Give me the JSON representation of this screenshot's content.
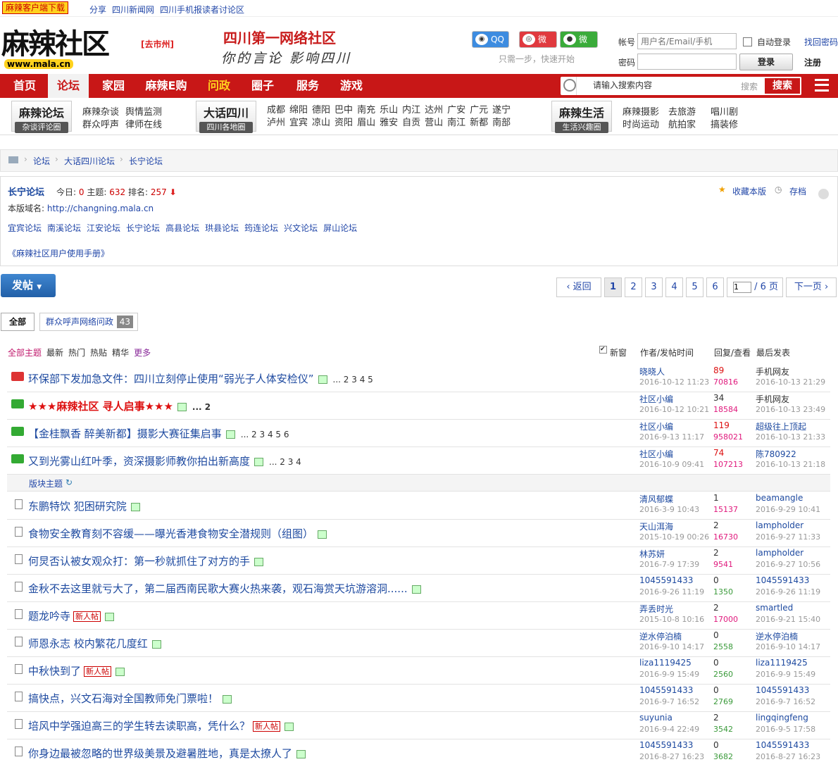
{
  "topbar": {
    "download": "麻辣客户端下载",
    "links": [
      "分享",
      "四川新闻网",
      "四川手机报读者讨论区"
    ]
  },
  "header": {
    "logo": "麻辣社区",
    "logo_url": "www.mala.cn",
    "city": "[去市州]",
    "slogan1": "四川第一网络社区",
    "slogan2": "你的言论 影响四川",
    "social": {
      "qq": "QQ",
      "weibo": "微博",
      "weixin": "微信",
      "quick": "只需一步，快速开始"
    },
    "login": {
      "account_label": "帐号",
      "account_placeholder": "用户名/Email/手机",
      "auto": "自动登录",
      "find_pwd": "找回密码",
      "pwd_label": "密码",
      "login_btn": "登录",
      "register": "注册"
    }
  },
  "nav": {
    "items": [
      "首页",
      "论坛",
      "家园",
      "麻辣E购",
      "问政",
      "圈子",
      "服务",
      "游戏"
    ],
    "search_placeholder": "请输入搜索内容",
    "search_hint": "搜索",
    "search_btn": "搜索"
  },
  "subnav": {
    "box1": {
      "title": "麻辣论坛",
      "sub": "杂谈评论圈"
    },
    "links1": [
      "麻辣杂谈",
      "舆情监测",
      "群众呼声",
      "律师在线"
    ],
    "box2": {
      "title": "大话四川",
      "sub": "四川各地圈"
    },
    "links2a": [
      "成都",
      "绵阳",
      "德阳",
      "巴中",
      "南充",
      "乐山",
      "内江",
      "达州",
      "广安",
      "广元",
      "遂宁"
    ],
    "links2b": [
      "泸州",
      "宜宾",
      "凉山",
      "资阳",
      "眉山",
      "雅安",
      "自贡",
      "营山",
      "南江",
      "新都",
      "南部"
    ],
    "box3": {
      "title": "麻辣生活",
      "sub": "生活兴趣圈"
    },
    "links3": [
      "麻辣摄影",
      "去旅游",
      "唱川剧",
      "时尚运动",
      "航拍家",
      "搞装修"
    ]
  },
  "breadcrumb": [
    "论坛",
    "大话四川论坛",
    "长宁论坛"
  ],
  "forum": {
    "name": "长宁论坛",
    "today_label": "今日:",
    "today": "0",
    "topics_label": "主题:",
    "topics": "632",
    "rank_label": "排名:",
    "rank": "257",
    "domain_label": "本版域名:",
    "domain": "http://changning.mala.cn",
    "fav": "收藏本版",
    "archive": "存档",
    "related": [
      "宜宾论坛",
      "南溪论坛",
      "江安论坛",
      "长宁论坛",
      "高县论坛",
      "珙县论坛",
      "筠连论坛",
      "兴文论坛",
      "屏山论坛"
    ],
    "manual": "《麻辣社区用户使用手册》"
  },
  "toolbar": {
    "post": "发帖",
    "back": "返回",
    "pages": [
      "1",
      "2",
      "3",
      "4",
      "5",
      "6"
    ],
    "page_input": "1",
    "total": "/ 6 页",
    "next": "下一页"
  },
  "tabs": {
    "all": "全部",
    "cat": "群众呼声网络问政",
    "cat_count": "43"
  },
  "list_header": {
    "filters": [
      "全部主题",
      "最新",
      "热门",
      "热贴",
      "精华",
      "更多"
    ],
    "newwin": "新窗",
    "author": "作者/发帖时间",
    "reply": "回复/查看",
    "last": "最后发表"
  },
  "section_label": "版块主题",
  "sticky": [
    {
      "title": "环保部下发加急文件：四川立刻停止使用“弱光子人体安检仪”",
      "pages": "... 2  3  4  5",
      "author": "晓晓人",
      "date": "2016-10-12 11:23",
      "replies": "89",
      "views": "70816",
      "last": "手机网友",
      "last_date": "2016-10-13 21:29"
    },
    {
      "title": "★★★麻辣社区 寻人启事★★★",
      "pages": "... 2",
      "author": "社区小编",
      "date": "2016-10-12 10:21",
      "replies": "34",
      "views": "18584",
      "last": "手机网友",
      "last_date": "2016-10-13 23:49"
    },
    {
      "title": "【金桂飘香 醉美新都】摄影大赛征集启事",
      "pages": "... 2  3  4  5  6",
      "author": "社区小编",
      "date": "2016-9-13 11:17",
      "replies": "119",
      "views": "958021",
      "last": "超级往上顶起",
      "last_date": "2016-10-13 21:33"
    },
    {
      "title": "又到光雾山红叶季，资深摄影师教你拍出新高度",
      "pages": "... 2  3  4",
      "author": "社区小编",
      "date": "2016-10-9 09:41",
      "replies": "74",
      "views": "107213",
      "last": "陈780922",
      "last_date": "2016-10-13 21:18"
    }
  ],
  "threads": [
    {
      "title": "东鹏特饮 犯困研究院",
      "author": "清风郁蝶",
      "date": "2016-3-9 10:43",
      "replies": "1",
      "views": "15137",
      "last": "beamangle",
      "last_date": "2016-9-29 10:41"
    },
    {
      "title": "食物安全教育刻不容缓——曝光香港食物安全潜规则（组图）",
      "author": "天山洱海",
      "date": "2015-10-19 00:26",
      "replies": "2",
      "views": "16730",
      "last": "lampholder",
      "last_date": "2016-9-27 11:33"
    },
    {
      "title": "何炅否认被女观众打：第一秒就抓住了对方的手",
      "author": "林苏妍",
      "date": "2016-7-9 17:39",
      "replies": "2",
      "views": "9541",
      "last": "lampholder",
      "last_date": "2016-9-27 10:56"
    },
    {
      "title": "金秋不去这里就亏大了，第二届西南民歌大赛火热来袭，观石海赏天坑游溶洞......",
      "author": "1045591433",
      "date": "2016-9-26 11:19",
      "replies": "0",
      "views": "1350",
      "last": "1045591433",
      "last_date": "2016-9-26 11:19"
    },
    {
      "title": "题龙吟寺",
      "tag": "新人帖",
      "author": "弄丢时光",
      "date": "2015-10-8 10:16",
      "replies": "2",
      "views": "17000",
      "last": "smartled",
      "last_date": "2016-9-21 15:40"
    },
    {
      "title": "师恩永志 校内繁花几度红",
      "author": "逆水停泊楠",
      "date": "2016-9-10 14:17",
      "replies": "0",
      "views": "2558",
      "last": "逆水停泊楠",
      "last_date": "2016-9-10 14:17"
    },
    {
      "title": "中秋快到了",
      "tag": "新人帖",
      "author": "liza1119425",
      "date": "2016-9-9 15:49",
      "replies": "0",
      "views": "2560",
      "last": "liza1119425",
      "last_date": "2016-9-9 15:49"
    },
    {
      "title": "搞快点，兴文石海对全国教师免门票啦！",
      "author": "1045591433",
      "date": "2016-9-7 16:52",
      "replies": "0",
      "views": "2769",
      "last": "1045591433",
      "last_date": "2016-9-7 16:52"
    },
    {
      "title": "培风中学强迫高三的学生转去读职高，凭什么？",
      "tag": "新人帖",
      "author": "suyunia",
      "date": "2016-9-4 22:49",
      "replies": "2",
      "views": "3542",
      "last": "lingqingfeng",
      "last_date": "2016-9-5 17:58"
    },
    {
      "title": "你身边最被忽略的世界级美景及避暑胜地，真是太撩人了",
      "author": "1045591433",
      "date": "2016-8-27 16:23",
      "replies": "0",
      "views": "3682",
      "last": "1045591433",
      "last_date": "2016-8-27 16:23"
    }
  ]
}
